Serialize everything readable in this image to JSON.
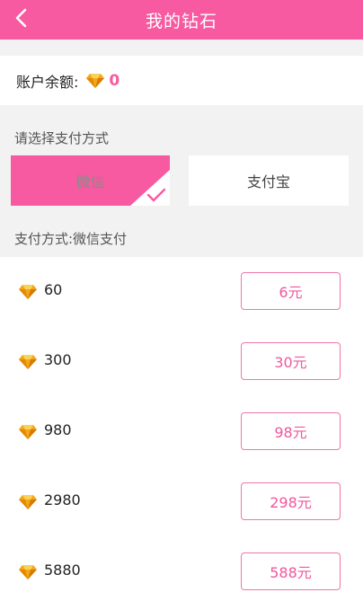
{
  "header": {
    "title": "我的钻石"
  },
  "balance": {
    "label": "账户余额:",
    "value": "0"
  },
  "payment": {
    "section_title": "请选择支付方式",
    "options": [
      {
        "label": "微信",
        "selected": true
      },
      {
        "label": "支付宝",
        "selected": false
      }
    ],
    "current_method": "支付方式:微信支付"
  },
  "packages": [
    {
      "amount": "60",
      "price": "6元"
    },
    {
      "amount": "300",
      "price": "30元"
    },
    {
      "amount": "980",
      "price": "98元"
    },
    {
      "amount": "2980",
      "price": "298元"
    },
    {
      "amount": "5880",
      "price": "588元"
    }
  ],
  "icons": {
    "back": "back-arrow-icon",
    "diamond": "diamond-icon",
    "check": "checkmark-icon"
  },
  "colors": {
    "accent": "#f75aa0",
    "diamond": "#f0a000"
  }
}
